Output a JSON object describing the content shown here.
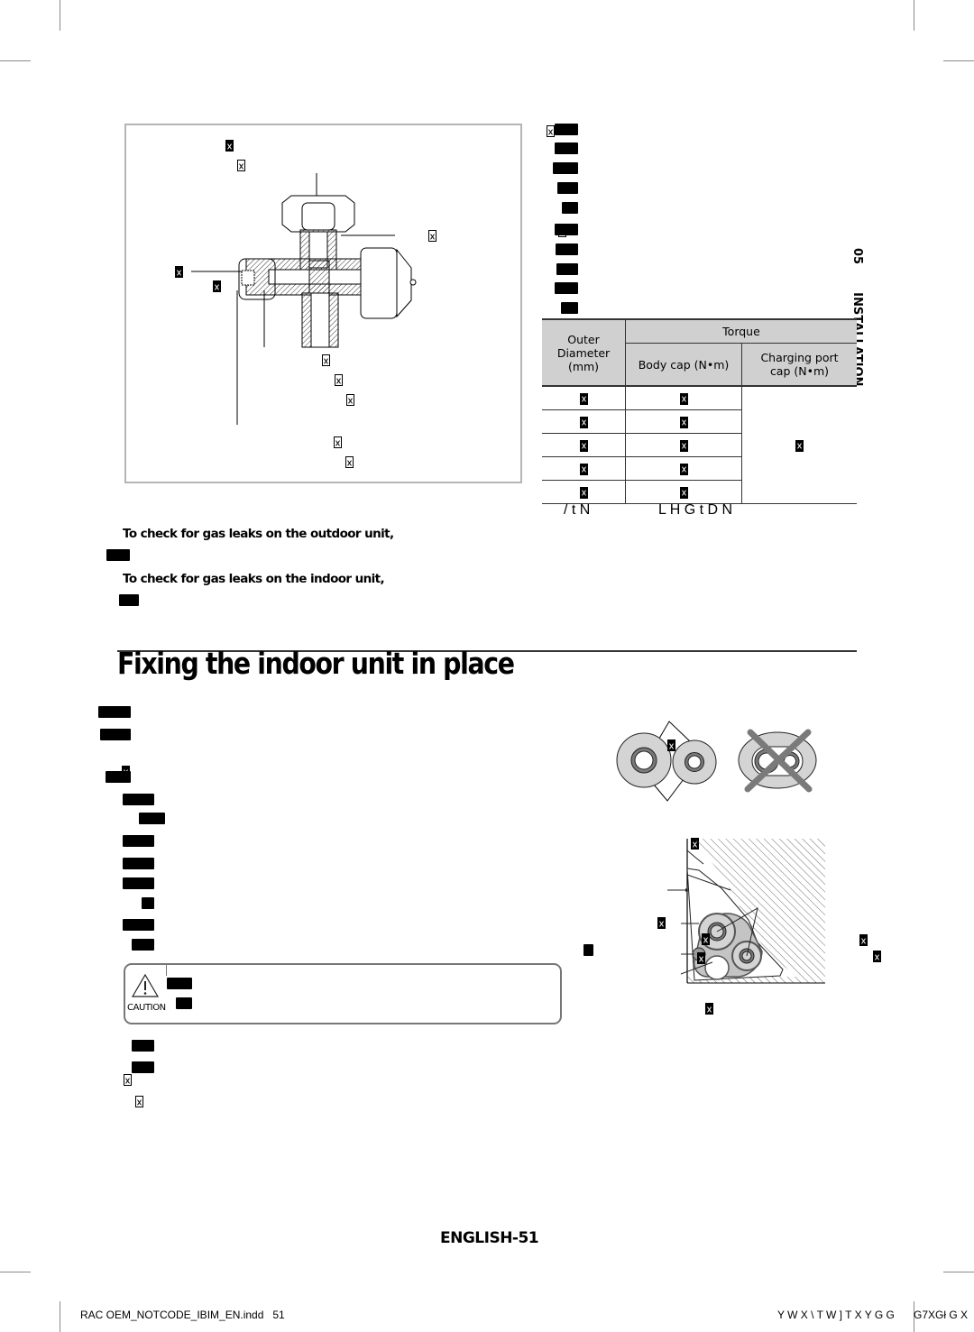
{
  "section_tab": {
    "number": "05",
    "label": "INSTALLATION"
  },
  "valve_figure": {
    "description": "Cross-section of service valve with charging port",
    "labels_missing_glyphs": 10
  },
  "torque_table": {
    "headers": {
      "outer_diameter": "Outer Diameter (mm)",
      "outer_line1": "Outer",
      "outer_line2": "Diameter",
      "outer_line3": "(mm)",
      "torque": "Torque",
      "body_cap": "Body cap (N•m)",
      "charging_port_line1": "Charging port",
      "charging_port_line2": "cap (N•m)"
    },
    "rows": [
      {
        "outer_diameter": "⊠",
        "body_cap": "⊠"
      },
      {
        "outer_diameter": "⊠",
        "body_cap": "⊠"
      },
      {
        "outer_diameter": "⊠",
        "body_cap": "⊠"
      },
      {
        "outer_diameter": "⊠",
        "body_cap": "⊠"
      },
      {
        "outer_diameter": "⊠",
        "body_cap": "⊠"
      }
    ],
    "charging_port_value": "⊠",
    "footer_left": "/ t N",
    "footer_right": "L H G t D N"
  },
  "gas_leak": {
    "outdoor": "To check for gas leaks on the outdoor unit,",
    "indoor": "To check for gas leaks on the indoor unit,"
  },
  "section": {
    "title": "Fixing the indoor unit in place"
  },
  "caution": {
    "label": "CAUTION"
  },
  "pipe_figure": {
    "description": "Correct vs incorrect pipe insulation arrangement; pipe bundle placement in indoor unit"
  },
  "footer": {
    "page_label": "ENGLISH-51",
    "file_info": "RAC OEM_NOTCODE_IBIM_EN.indd   51",
    "garbled_date": "Y W X \\ T W ] T X Y G G",
    "garbled_time": "G7XGł G X"
  }
}
